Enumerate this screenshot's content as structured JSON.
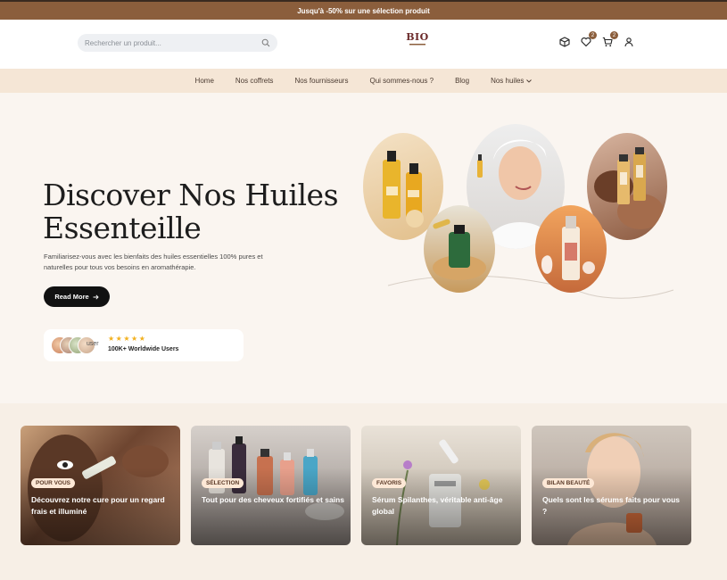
{
  "announcement": "Jusqu'à -50% sur une sélection produit",
  "header": {
    "search_placeholder": "Rechercher un produit...",
    "logo_text": "BIO",
    "wishlist_count": "2",
    "cart_count": "2"
  },
  "nav": {
    "items": [
      "Home",
      "Nos coffrets",
      "Nos fournisseurs",
      "Qui sommes-nous ?",
      "Blog",
      "Nos huiles"
    ]
  },
  "hero": {
    "title": "Discover Nos Huiles Essenteille",
    "subtitle": "Familiarisez-vous avec les bienfaits des huiles essentielles 100% pures et naturelles pour tous vos besoins en aromathérapie.",
    "cta": "Read More",
    "avatars_alt": "user",
    "rating": "★★★★★",
    "users_count": "100K+ Worldwide Users"
  },
  "cards": [
    {
      "tag": "POUR VOUS",
      "title": "Découvrez notre cure pour un regard frais et illuminé"
    },
    {
      "tag": "SÉLECTION",
      "title": "Tout pour des cheveux fortifiés et sains"
    },
    {
      "tag": "FAVORIS",
      "title": "Sérum Spilanthes, véritable anti-âge global"
    },
    {
      "tag": "BILAN BEAUTÉ",
      "title": "Quels sont les sérums faits pour vous ?"
    }
  ],
  "colors": {
    "brand": "#8b5e3c",
    "nav_bg": "#f5e6d6",
    "page_bg": "#faf5f0",
    "star": "#f2b01e"
  },
  "icons": [
    "search-icon",
    "box-icon",
    "heart-icon",
    "cart-icon",
    "user-icon",
    "chevron-down-icon",
    "arrow-right-icon"
  ]
}
